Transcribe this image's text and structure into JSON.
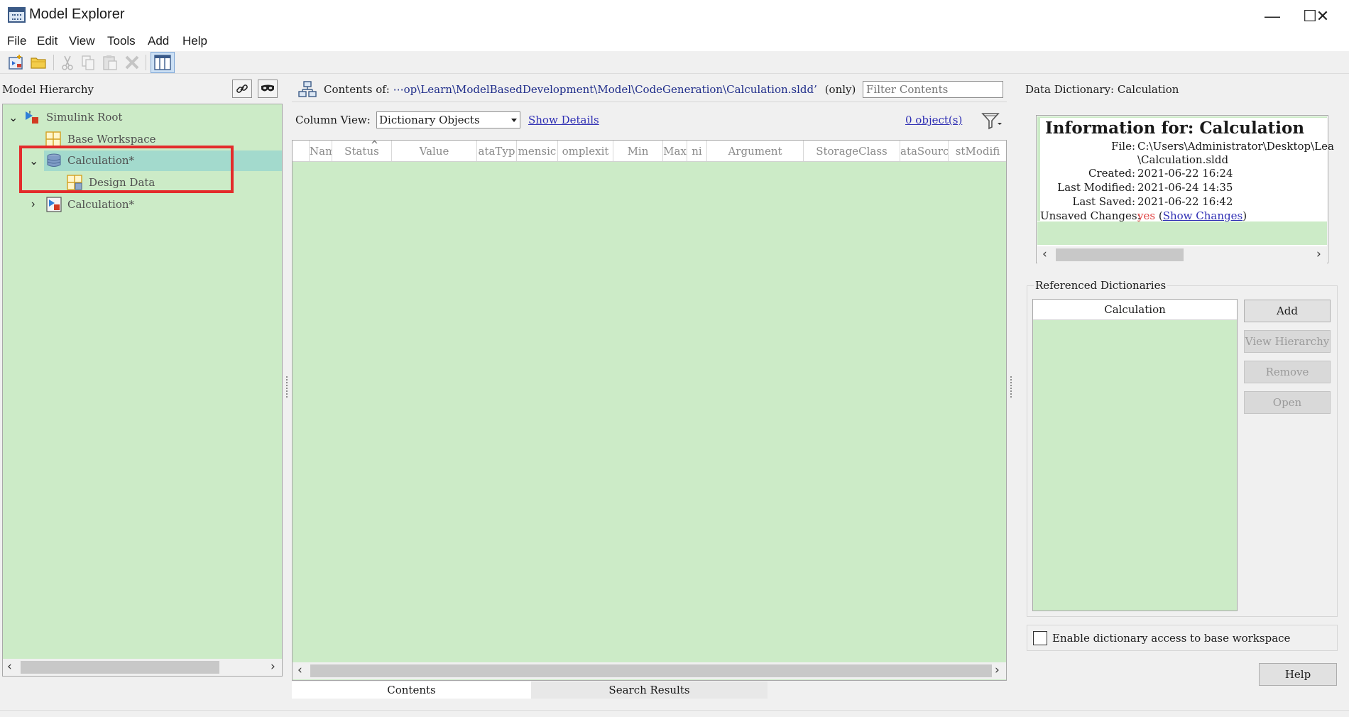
{
  "window": {
    "title": "Model Explorer",
    "controls": {
      "minimize": "—",
      "maximize": "☐",
      "close": "✕"
    }
  },
  "menu": [
    "File",
    "Edit",
    "View",
    "Tools",
    "Add",
    "Help"
  ],
  "toolbar": {
    "icons": [
      "new-model-icon",
      "open-icon",
      "cut-icon",
      "copy-icon",
      "paste-icon",
      "delete-icon",
      "column-view-icon"
    ]
  },
  "left_pane": {
    "header": "Model Hierarchy",
    "tree": [
      {
        "label": "Simulink Root",
        "icon": "simulink-root-icon",
        "expanded": true
      },
      {
        "label": "Base Workspace",
        "icon": "workspace-icon"
      },
      {
        "label": "Calculation*",
        "icon": "dictionary-icon",
        "expanded": true,
        "selected": true
      },
      {
        "label": "Design Data",
        "icon": "design-data-icon"
      },
      {
        "label": "Calculation*",
        "icon": "model-icon",
        "expanded": false
      }
    ]
  },
  "center_pane": {
    "contents_prefix": "Contents of:",
    "contents_path": "⋯op\\Learn\\ModelBasedDevelopment\\Model\\CodeGeneration\\Calculation.sldd’",
    "contents_suffix": "(only)",
    "filter_placeholder": "Filter Contents",
    "column_view_label": "Column View:",
    "column_view_value": "Dictionary Objects",
    "show_details": "Show Details",
    "object_count": "0 object(s)",
    "columns": [
      "Name",
      "Status",
      "Value",
      "ataTyp",
      "mensic",
      "omplexit",
      "Min",
      "Max",
      "ni",
      "Argument",
      "StorageClass",
      "ataSourc",
      "stModifi"
    ],
    "tabs": [
      "Contents",
      "Search Results"
    ]
  },
  "right_pane": {
    "title": "Data Dictionary: Calculation",
    "info": {
      "heading": "Information for: Calculation",
      "file_key": "File:",
      "file_line1": "C:\\Users\\Administrator\\Desktop\\Lea",
      "file_line2": "\\Calculation.sldd",
      "created_key": "Created:",
      "created": "2021-06-22 16:24",
      "modified_key": "Last Modified:",
      "modified": "2021-06-24 14:35",
      "saved_key": "Last Saved:",
      "saved": "2021-06-22 16:42",
      "unsaved_key": "Unsaved Changes:",
      "unsaved": "yes",
      "show_changes": "Show Changes",
      "open_paren": "(",
      "close_paren": ")"
    },
    "referenced": {
      "label": "Referenced Dictionaries",
      "list_header": "Calculation",
      "buttons": {
        "add": "Add",
        "view_hierarchy": "View Hierarchy",
        "remove": "Remove",
        "open": "Open"
      }
    },
    "enable_label": "Enable dictionary access to base workspace",
    "help": "Help"
  },
  "colors": {
    "pane_green": "#ccebc7",
    "selection": "#a3dacd",
    "highlight_box": "#e32b2b",
    "link": "#2f2fb4",
    "unsaved_red": "#e04040"
  }
}
